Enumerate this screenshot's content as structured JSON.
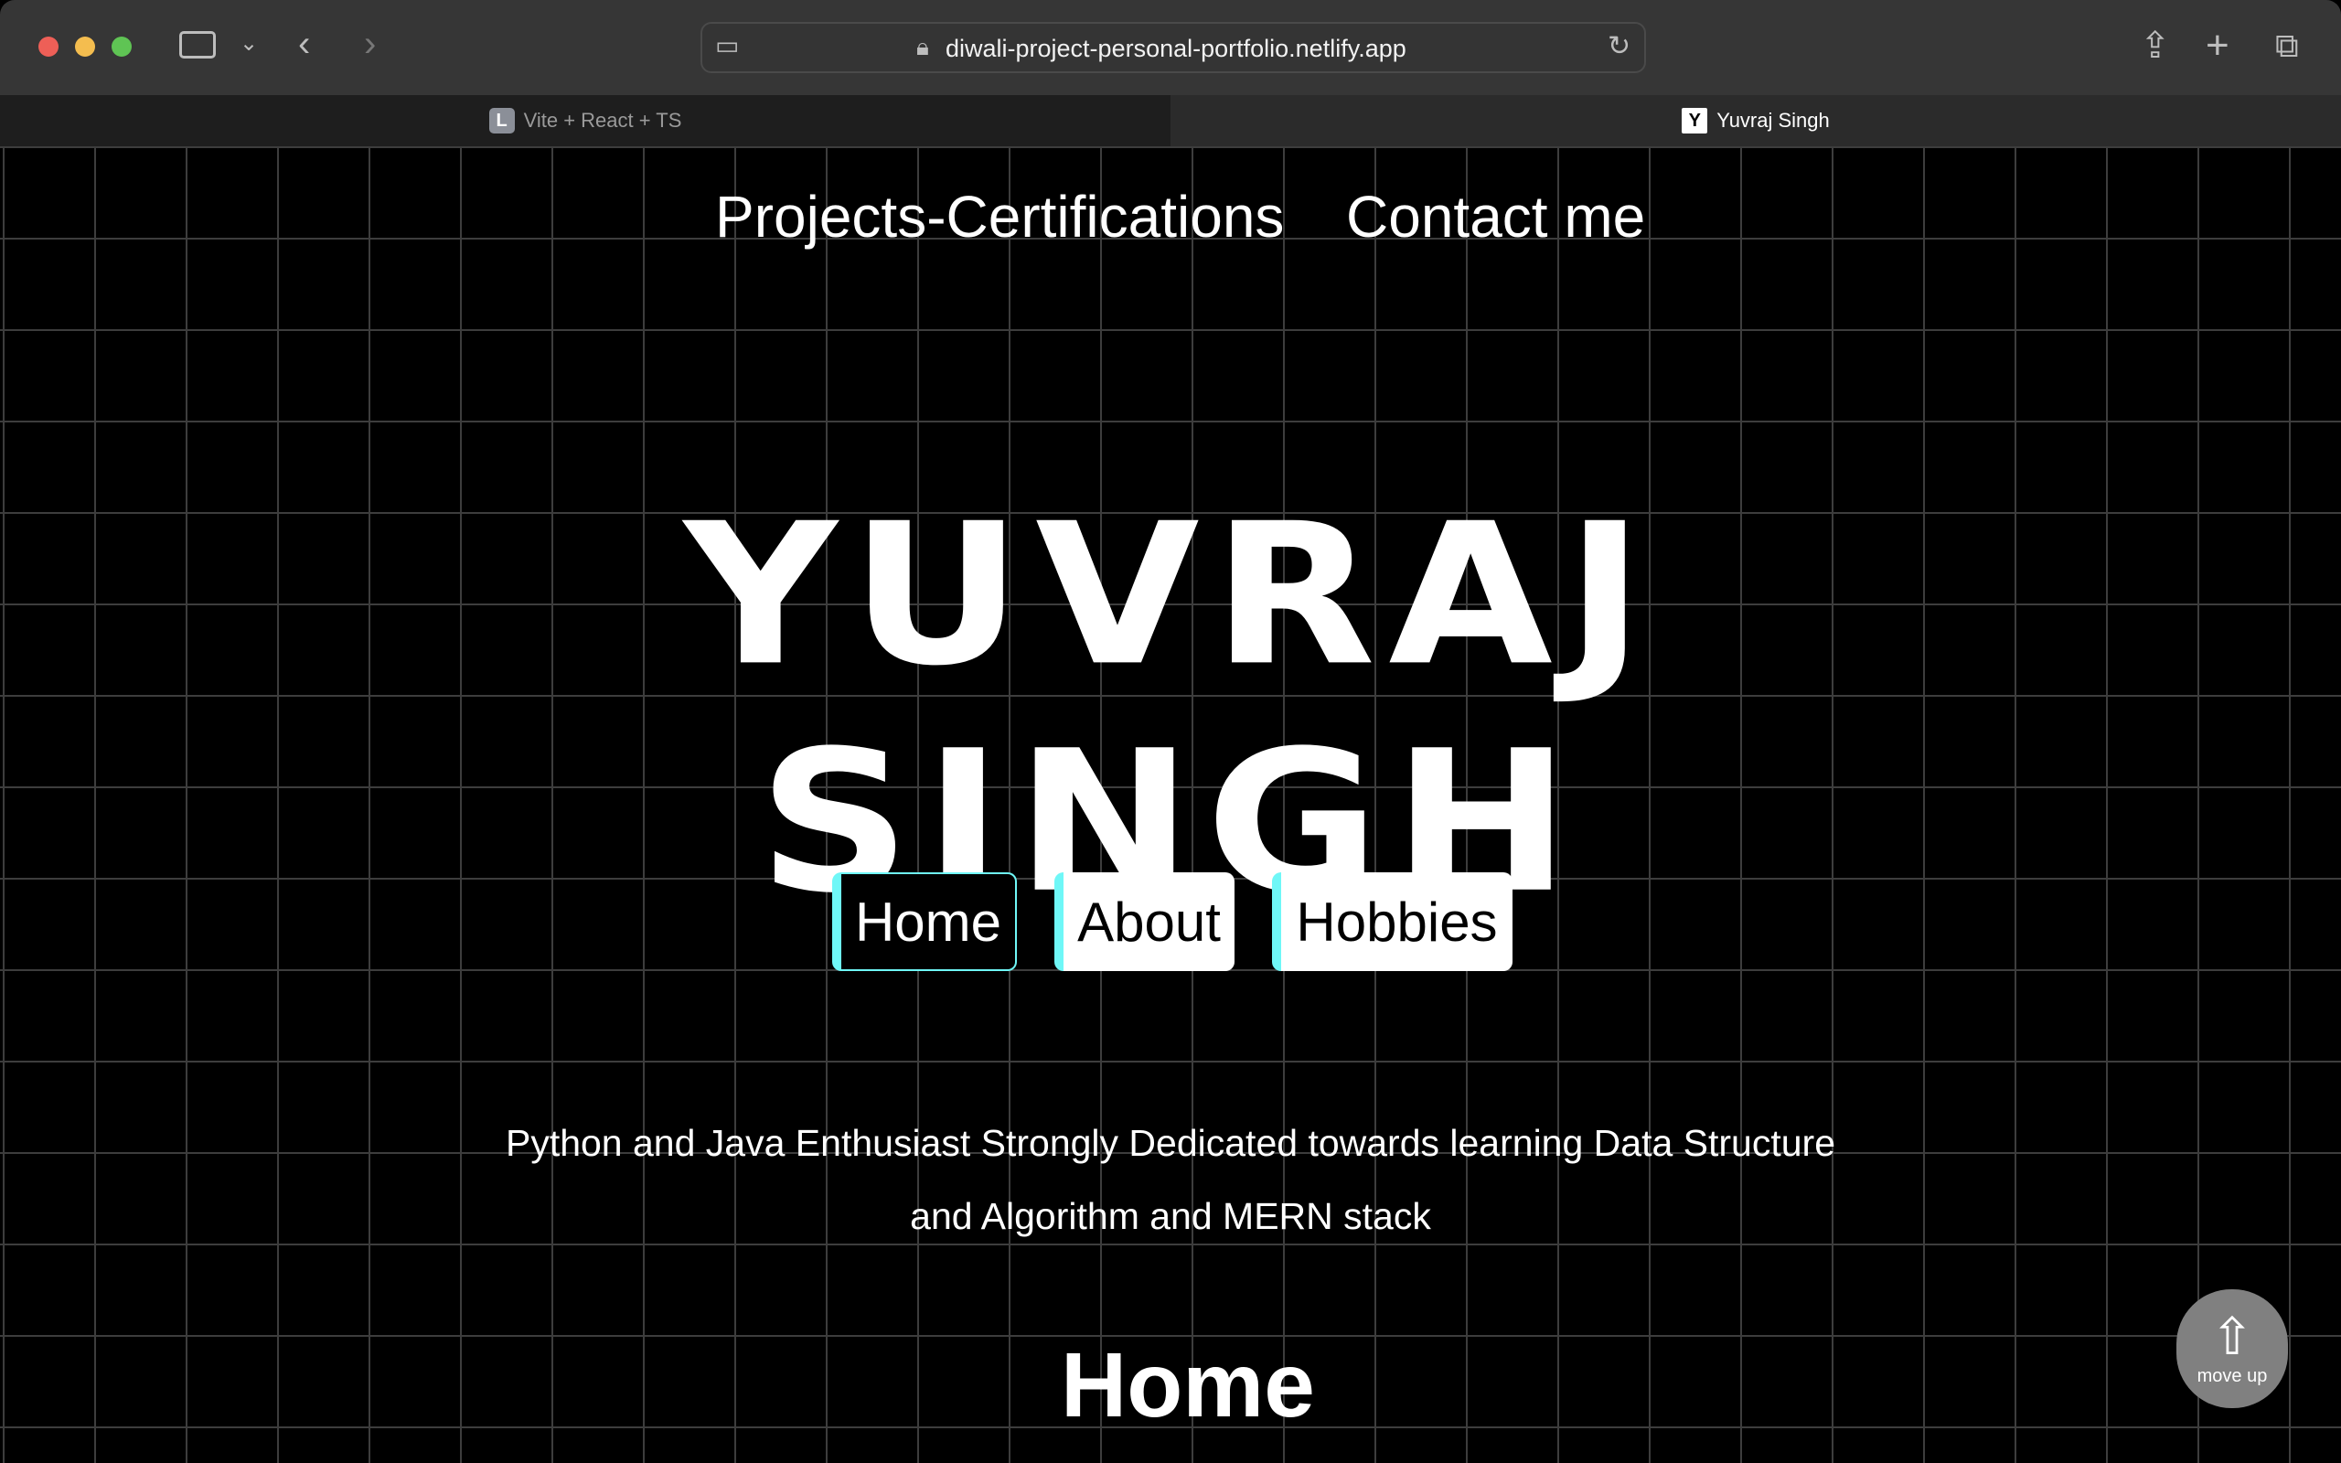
{
  "browser": {
    "url": "diwali-project-personal-portfolio.netlify.app",
    "tabs": [
      {
        "label": "Vite + React + TS",
        "favicon": "L"
      },
      {
        "label": "Yuvraj Singh",
        "favicon": "Y"
      }
    ]
  },
  "nav": {
    "projects": "Projects-Certifications",
    "contact": "Contact me"
  },
  "hero": {
    "title": "YUVRAJ SINGH"
  },
  "buttons": [
    {
      "label": "Home"
    },
    {
      "label": "About"
    },
    {
      "label": "Hobbies"
    }
  ],
  "description": {
    "line1": "Python and Java Enthusiast Strongly Dedicated towards learning Data Structure",
    "line2": "and Algorithm and MERN stack"
  },
  "section_heading": "Home",
  "move_up": {
    "label": "move up",
    "icon": "arrow-up-icon"
  },
  "colors": {
    "accent": "#6ff7f7",
    "background": "#000000"
  }
}
